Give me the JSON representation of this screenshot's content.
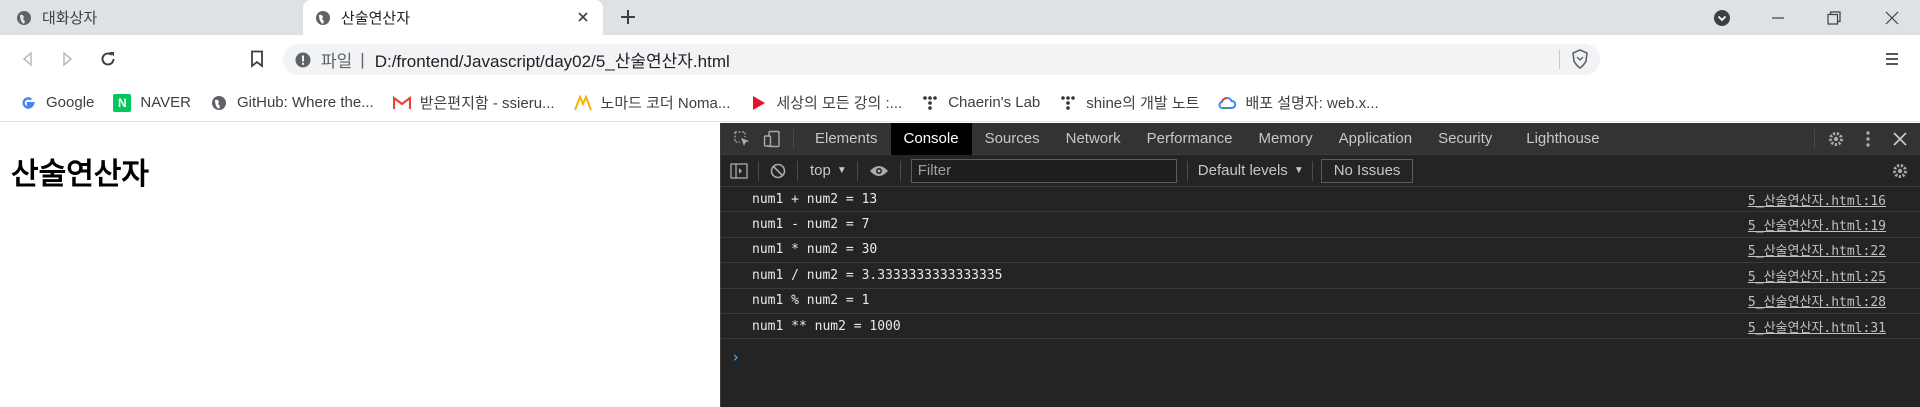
{
  "tabs": [
    {
      "title": "대화상자",
      "active": false
    },
    {
      "title": "산술연산자",
      "active": true
    }
  ],
  "address": {
    "scheme_label": "파일",
    "url": "D:/frontend/Javascript/day02/5_산술연산자.html"
  },
  "bookmarks": [
    {
      "label": "Google",
      "icon": "google-icon"
    },
    {
      "label": "NAVER",
      "icon": "naver-icon"
    },
    {
      "label": "GitHub: Where the...",
      "icon": "globe-icon"
    },
    {
      "label": "받은편지함 - ssieru...",
      "icon": "gmail-icon"
    },
    {
      "label": "노마드 코더 Noma...",
      "icon": "nomad-icon"
    },
    {
      "label": "세상의 모든 강의 :...",
      "icon": "play-icon"
    },
    {
      "label": "Chaerin's Lab",
      "icon": "tree-icon"
    },
    {
      "label": "shine의 개발 노트",
      "icon": "tree-icon"
    },
    {
      "label": "배포 설명자: web.x...",
      "icon": "gcloud-icon"
    }
  ],
  "page": {
    "heading": "산술연산자"
  },
  "devtools": {
    "tabs": [
      "Elements",
      "Console",
      "Sources",
      "Network",
      "Performance",
      "Memory",
      "Application",
      "Security",
      "Lighthouse"
    ],
    "selected_tab": "Console",
    "context": "top",
    "filter_placeholder": "Filter",
    "levels": "Default levels",
    "issues": "No Issues",
    "logs": [
      {
        "message": "num1 + num2 = 13",
        "source": "5_산술연산자.html:16"
      },
      {
        "message": "num1 - num2 = 7",
        "source": "5_산술연산자.html:19"
      },
      {
        "message": "num1 * num2 = 30",
        "source": "5_산술연산자.html:22"
      },
      {
        "message": "num1 / num2 = 3.3333333333333335",
        "source": "5_산술연산자.html:25"
      },
      {
        "message": "num1 % num2 = 1",
        "source": "5_산술연산자.html:28"
      },
      {
        "message": "num1 ** num2 = 1000",
        "source": "5_산술연산자.html:31"
      }
    ],
    "prompt": "›"
  }
}
